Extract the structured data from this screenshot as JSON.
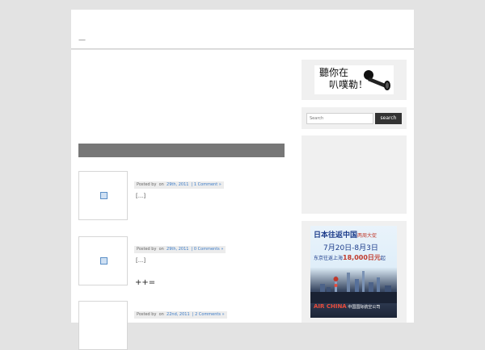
{
  "header": {
    "logo_text": "—"
  },
  "posts": [
    {
      "title": "",
      "meta_posted_by": "Posted by",
      "meta_on": "on",
      "meta_date": "29th, 2011",
      "meta_comments": "| 1 Comment »",
      "excerpt": "[...]"
    },
    {
      "title": "",
      "meta_posted_by": "Posted by",
      "meta_on": "on",
      "meta_date": "29th, 2011",
      "meta_comments": "| 0 Comments »",
      "excerpt": "[...]"
    },
    {
      "title": "++=",
      "meta_posted_by": "Posted by",
      "meta_on": "on",
      "meta_date": "22nd, 2011",
      "meta_comments": "| 2 Comments »",
      "excerpt": ""
    }
  ],
  "sidebar": {
    "banner": {
      "line1": "聽你在",
      "line2": "叭噗勒！"
    },
    "search": {
      "placeholder": "Search",
      "button": "search"
    },
    "ad": {
      "line1_main": "日本往返中国",
      "line1_sub": "两周大促",
      "line2": "7月20日-8月3日",
      "line3_prefix": "东京往返上海",
      "line3_price": "18,000日元",
      "line3_suffix": "起",
      "brand_logo": "AIR CHINA",
      "brand_text": "中国国际航空公司"
    }
  },
  "colors": {
    "page_bg": "#e3e3e3",
    "section_bar": "#777777",
    "link": "#3a7bc8",
    "search_button": "#333333"
  }
}
